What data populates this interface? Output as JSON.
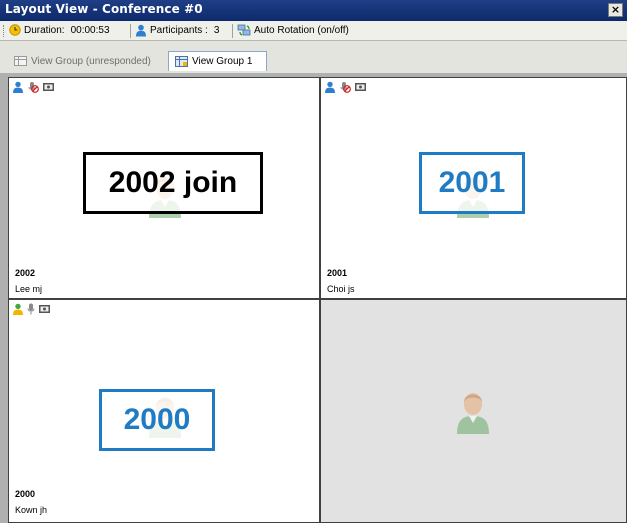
{
  "window": {
    "title": "Layout View - Conference #0",
    "close_glyph": "×"
  },
  "toolbar": {
    "duration_label": "Duration:",
    "duration_value": "00:00:53",
    "participants_label": "Participants :",
    "participants_count": "3",
    "auto_rotation_label": "Auto Rotation (on/off)"
  },
  "tabs": [
    {
      "label": "View Group (unresponded)",
      "active": false
    },
    {
      "label": "View Group 1",
      "active": true
    }
  ],
  "cells": [
    {
      "id": "2002",
      "name": "Lee mj",
      "overlay": "2002 join",
      "overlay_color": "#000000",
      "icons": [
        "user-icon",
        "mic-muted-icon",
        "video-icon"
      ]
    },
    {
      "id": "2001",
      "name": "Choi js",
      "overlay": "2001",
      "overlay_color": "#1f7bc3",
      "icons": [
        "user-icon",
        "mic-muted-icon",
        "video-icon"
      ]
    },
    {
      "id": "2000",
      "name": "Kown jh",
      "overlay": "2000",
      "overlay_color": "#1f7bc3",
      "icons": [
        "user-speaking-icon",
        "mic-icon",
        "video-icon"
      ]
    },
    {
      "empty": true
    }
  ],
  "colors": {
    "titlebar": "#0c2a6b",
    "accent_blue": "#1f7bc3",
    "empty_cell": "#e2e2e2"
  }
}
